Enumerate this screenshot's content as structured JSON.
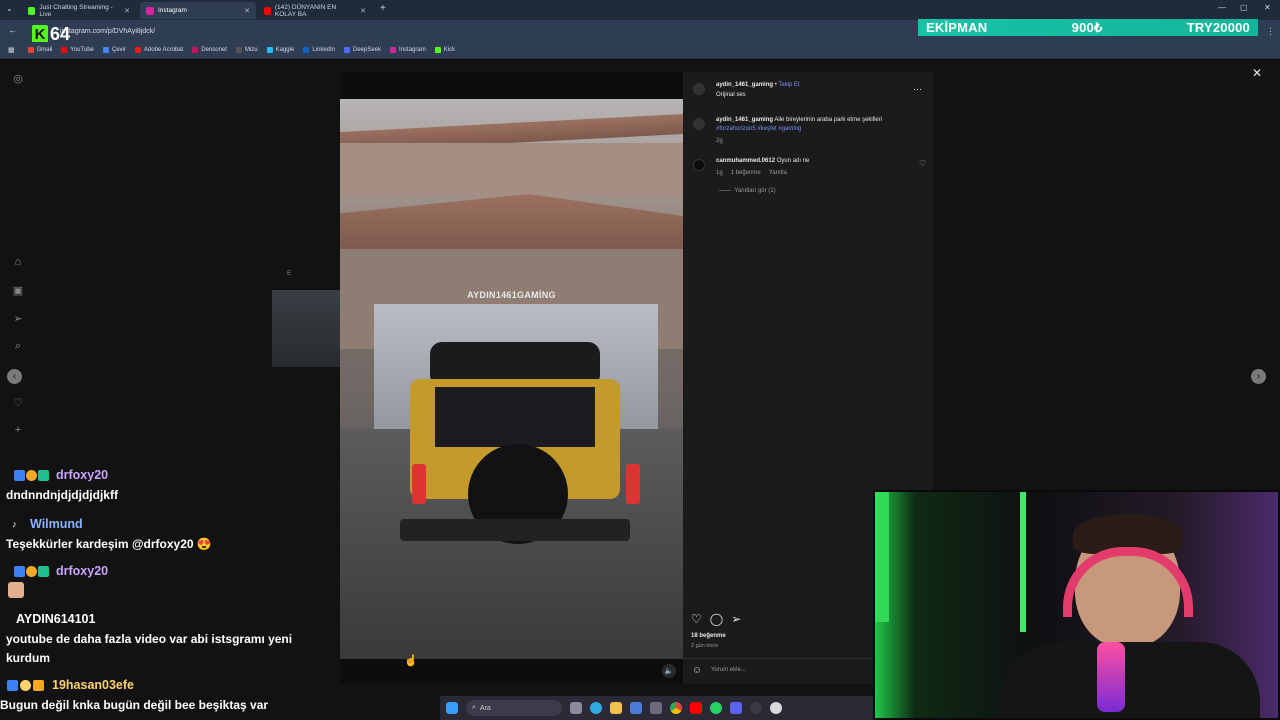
{
  "browser": {
    "tabs": [
      {
        "label": "Just Chatting Streaming - Live",
        "color": "#53fc18",
        "active": false
      },
      {
        "label": "Instagram",
        "color": "#d6249f",
        "active": true
      },
      {
        "label": "(142) DÜNYANIN EN KOLAY BA",
        "color": "#ff0000",
        "active": false
      }
    ],
    "url": "instagram.com/p/DVhAyi8jdck/",
    "bookmarks": [
      {
        "label": "Gmail",
        "color": "#ea4335"
      },
      {
        "label": "YouTube",
        "color": "#ff0000"
      },
      {
        "label": "Çevir",
        "color": "#4285f4"
      },
      {
        "label": "Adobe Acrobat",
        "color": "#e02020"
      },
      {
        "label": "Densonet",
        "color": "#c2185b"
      },
      {
        "label": "Mizu",
        "color": "#555555"
      },
      {
        "label": "Kaggle",
        "color": "#20beff"
      },
      {
        "label": "LinkedIn",
        "color": "#0a66c2"
      },
      {
        "label": "DeepSeek",
        "color": "#4d6bfe"
      },
      {
        "label": "Instagram",
        "color": "#d6249f"
      },
      {
        "label": "Kick",
        "color": "#53fc18"
      }
    ]
  },
  "overlay": {
    "kick_number": "64",
    "ekipman_label": "EKİPMAN",
    "ekipman_price": "900₺",
    "ekipman_goal": "TRY20000"
  },
  "post": {
    "username": "aydin_1461_gaming",
    "follow": "Takip Et",
    "audio": "Orijinal ses",
    "watermark": "AYDIN1461GAMİNG",
    "caption_user": "aydin_1461_gaming",
    "caption_text": "Aile bireylerinin araba park etme şekilleri",
    "hashtags": "#forzahorizon5 #keşfet #gaming",
    "caption_age": "2g",
    "comment_user": "canmuhammed.0612",
    "comment_text": "Oyun adı ne",
    "comment_age": "1g",
    "comment_likes": "1 beğenme",
    "reply_label": "Yanıtla",
    "view_replies": "Yanıtları gör (1)",
    "likes": "18 beğenme",
    "post_age": "2 gün önce",
    "add_comment": "Yorum ekle..."
  },
  "side_preview": {
    "letter": "E"
  },
  "chat": [
    {
      "user": "drfoxy20",
      "color": "#c9a3ff",
      "message": "dndnndnjdjdjdjdjkff",
      "has_badges": true
    },
    {
      "user": "Wilmund",
      "color": "#8ab4ff",
      "message": "Teşekkürler kardeşim @drfoxy20 😍",
      "has_badges": false
    },
    {
      "user": "drfoxy20",
      "color": "#c9a3ff",
      "message": "",
      "has_badges": true
    },
    {
      "user": "AYDIN614101",
      "color": "#ffffff",
      "message": "youtube de daha fazla video var abi istsgramı yeni kurdum",
      "has_badges": false
    },
    {
      "user": "19hasan03efe",
      "color": "#ffd36b",
      "message": "Bugun değil knka bugün değil bee beşiktaş var",
      "has_badges": true
    }
  ],
  "taskbar": {
    "search_label": "Ara"
  }
}
